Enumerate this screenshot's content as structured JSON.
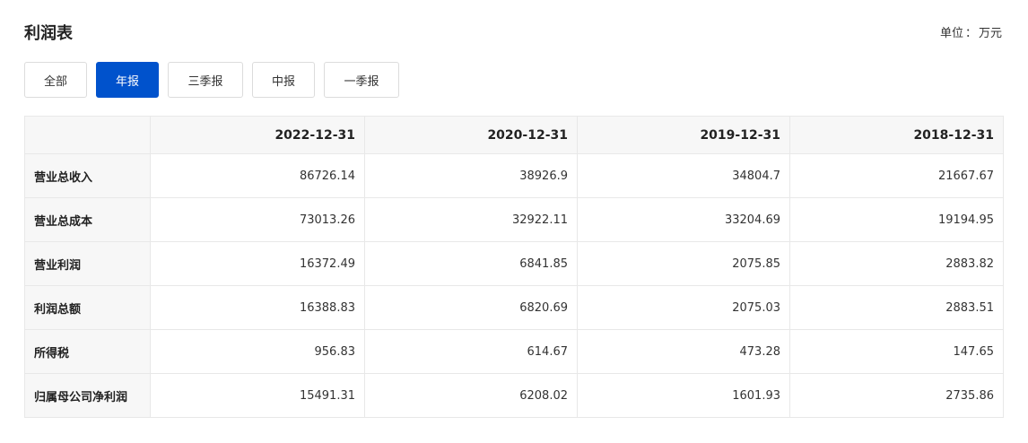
{
  "header": {
    "title": "利润表",
    "unit_label": "单位",
    "unit_sep": "：",
    "unit_value": "万元"
  },
  "tabs": [
    {
      "label": "全部",
      "active": false
    },
    {
      "label": "年报",
      "active": true
    },
    {
      "label": "三季报",
      "active": false
    },
    {
      "label": "中报",
      "active": false
    },
    {
      "label": "一季报",
      "active": false
    }
  ],
  "table": {
    "columns": [
      "",
      "2022-12-31",
      "2020-12-31",
      "2019-12-31",
      "2018-12-31"
    ],
    "rows": [
      {
        "label": "营业总收入",
        "values": [
          "86726.14",
          "38926.9",
          "34804.7",
          "21667.67"
        ]
      },
      {
        "label": "营业总成本",
        "values": [
          "73013.26",
          "32922.11",
          "33204.69",
          "19194.95"
        ]
      },
      {
        "label": "营业利润",
        "values": [
          "16372.49",
          "6841.85",
          "2075.85",
          "2883.82"
        ]
      },
      {
        "label": "利润总额",
        "values": [
          "16388.83",
          "6820.69",
          "2075.03",
          "2883.51"
        ]
      },
      {
        "label": "所得税",
        "values": [
          "956.83",
          "614.67",
          "473.28",
          "147.65"
        ]
      },
      {
        "label": "归属母公司净利润",
        "values": [
          "15491.31",
          "6208.02",
          "1601.93",
          "2735.86"
        ]
      }
    ]
  },
  "colors": {
    "accent": "#0052cc",
    "header_bg": "#f7f7f7",
    "border": "#e8e8e8"
  }
}
